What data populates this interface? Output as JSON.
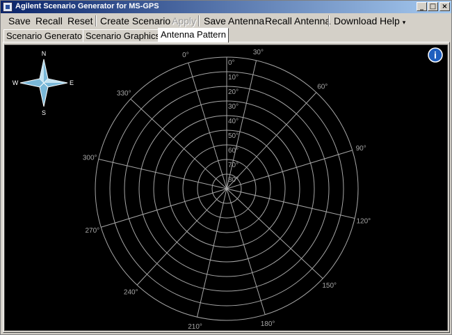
{
  "window": {
    "title": "Agilent Scenario Generator for MS-GPS",
    "min_glyph": "_",
    "max_glyph": "□",
    "close_glyph": "×"
  },
  "menu": [
    {
      "label": "Save",
      "enabled": true
    },
    {
      "label": "Recall",
      "enabled": true
    },
    {
      "label": "Reset",
      "enabled": true
    },
    {
      "label": "Create Scenario",
      "enabled": true
    },
    {
      "label": "Apply",
      "enabled": false
    },
    {
      "label": "Save Antenna",
      "enabled": true
    },
    {
      "label": "Recall Antenna",
      "enabled": true
    },
    {
      "label": "Download",
      "enabled": true
    },
    {
      "label": "Help",
      "enabled": true,
      "dropdown_glyph": "▾"
    }
  ],
  "tabs": [
    {
      "label": "Scenario Generator",
      "active": false
    },
    {
      "label": "Scenario Graphics",
      "active": false
    },
    {
      "label": "Antenna Pattern",
      "active": true
    }
  ],
  "compass": {
    "n": "N",
    "s": "S",
    "e": "E",
    "w": "W"
  },
  "info_icon": {
    "glyph": "i",
    "name": "info-icon"
  },
  "polar": {
    "elevation_labels": [
      "0°",
      "10°",
      "20°",
      "30°",
      "40°",
      "50°",
      "60°",
      "70°",
      "80°"
    ],
    "azimuth_labels": [
      "0°",
      "30°",
      "60°",
      "90°",
      "120°",
      "150°",
      "180°",
      "210°",
      "240°",
      "270°",
      "300°",
      "330°"
    ],
    "azimuth_values": [
      0,
      30,
      60,
      90,
      120,
      150,
      180,
      210,
      240,
      270,
      300,
      330
    ],
    "grid_color": "#a6a6a6",
    "label_color": "#a6a6a6"
  }
}
